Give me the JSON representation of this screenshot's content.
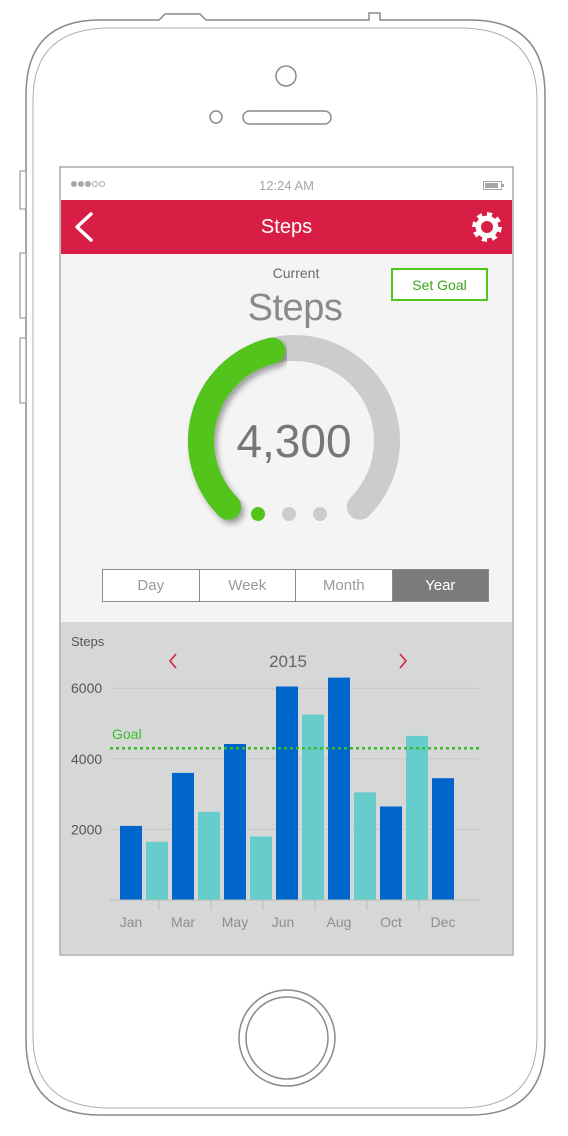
{
  "status_bar": {
    "time": "12:24 AM",
    "signal_total": 5,
    "signal_filled": 3
  },
  "header": {
    "title": "Steps",
    "back_icon": "chevron-left-icon",
    "settings_icon": "gear-icon",
    "color": "#d81e45"
  },
  "summary": {
    "current_label": "Current",
    "metric_label": "Steps",
    "set_goal_label": "Set Goal",
    "value_display": "4,300",
    "progress_fraction": 0.45,
    "accent_color": "#52c41a"
  },
  "pager": {
    "count": 3,
    "active_index": 0
  },
  "range_tabs": {
    "items": [
      "Day",
      "Week",
      "Month",
      "Year"
    ],
    "active": "Year"
  },
  "chart_data": {
    "type": "bar",
    "ylabel": "Steps",
    "year": "2015",
    "goal_label": "Goal",
    "goal_value": 4300,
    "yticks": [
      2000,
      4000,
      6000
    ],
    "ylim": [
      0,
      6800
    ],
    "x_tick_labels": [
      "Jan",
      "Mar",
      "May",
      "Jun",
      "Aug",
      "Oct",
      "Dec"
    ],
    "values": [
      2100,
      1650,
      3600,
      2500,
      4420,
      1800,
      6050,
      5250,
      6300,
      3050,
      2650,
      4650,
      3450
    ],
    "colors": [
      "#0066cc",
      "#66cccc",
      "#0066cc",
      "#66cccc",
      "#0066cc",
      "#66cccc",
      "#0066cc",
      "#66cccc",
      "#0066cc",
      "#66cccc",
      "#0066cc",
      "#66cccc",
      "#0066cc"
    ],
    "goal_color": "#3dbb2a",
    "grid": true
  }
}
